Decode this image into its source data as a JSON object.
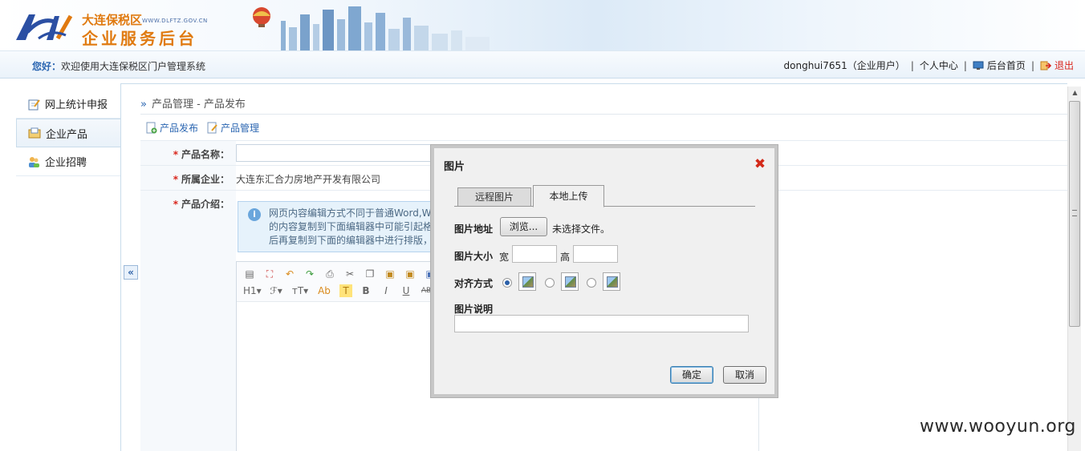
{
  "header": {
    "logo_title1": "大连保税区",
    "logo_url": "WWW.DLFTZ.GOV.CN",
    "logo_title2": "企业服务后台"
  },
  "welcome": {
    "greet_bold": "您好：",
    "greet_text": "欢迎使用大连保税区门户管理系统",
    "user": "donghui7651（企业用户）",
    "personal_center": "个人中心",
    "backend_home": "后台首页",
    "logout": "退出"
  },
  "sidebar": {
    "items": [
      {
        "label": "网上统计申报",
        "icon": "edit-report-icon"
      },
      {
        "label": "企业产品",
        "icon": "product-folder-icon"
      },
      {
        "label": "企业招聘",
        "icon": "people-icon"
      }
    ],
    "active_index": 1,
    "collapse_glyph": "«"
  },
  "main": {
    "breadcrumb": "产品管理 - 产品发布",
    "breadcrumb_arrow": "»",
    "actions": [
      "产品发布",
      "产品管理"
    ],
    "fields": {
      "name_label": "产品名称：",
      "company_label": "所属企业：",
      "company_value": "大连东汇合力房地产开发有限公司",
      "intro_label": "产品介绍："
    },
    "star": "*",
    "tip_lines": [
      "网页内容编辑方式不同于普通Word,Wp",
      "的内容复制到下面编辑器中可能引起格式",
      "后再复制到下面的编辑器中进行排版，若"
    ],
    "toolbar_row2": [
      "H1▾",
      "ℱ▾",
      "тT▾",
      "Ab",
      "T",
      "B",
      "I",
      "U",
      "AB"
    ]
  },
  "dialog": {
    "title": "图片",
    "close_glyph": "✖",
    "tabs": [
      "远程图片",
      "本地上传"
    ],
    "active_tab": 1,
    "path_label": "图片地址",
    "browse_label": "浏览...",
    "no_file_text": "未选择文件。",
    "size_label": "图片大小",
    "width_label": "宽",
    "height_label": "高",
    "align_label": "对齐方式",
    "align_selected": 0,
    "desc_label": "图片说明",
    "ok_label": "确定",
    "cancel_label": "取消"
  },
  "watermark": "www.wooyun.org",
  "colors": {
    "accent_blue": "#2b66b1",
    "logo_orange": "#e07a10",
    "required_red": "#d9261c"
  }
}
